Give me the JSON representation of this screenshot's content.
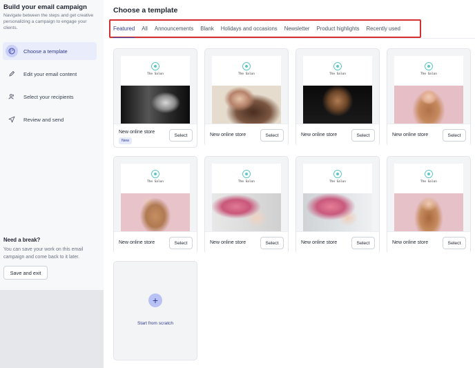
{
  "sidebar": {
    "title": "Build your email campaign",
    "description": "Navigate between the steps and get creative personalizing a campaign to engage your clients.",
    "steps": [
      {
        "label": "Choose a template",
        "icon": "palette-icon",
        "active": true
      },
      {
        "label": "Edit your email content",
        "icon": "pencil-icon",
        "active": false
      },
      {
        "label": "Select your recipients",
        "icon": "users-icon",
        "active": false
      },
      {
        "label": "Review and send",
        "icon": "send-icon",
        "active": false
      }
    ],
    "break_title": "Need a break?",
    "break_description": "You can save your work on this email campaign and come back to it later.",
    "save_exit_label": "Save and exit"
  },
  "main": {
    "title": "Choose a template",
    "tabs": [
      "Featured",
      "All",
      "Announcements",
      "Blank",
      "Holidays and occasions",
      "Newsletter",
      "Product highlights",
      "Recently used"
    ],
    "active_tab": "Featured",
    "cards": [
      {
        "brand": "The Salon",
        "name": "New online store",
        "badge": "New",
        "select": "Select"
      },
      {
        "brand": "The Salon",
        "name": "New online store",
        "badge": "",
        "select": "Select"
      },
      {
        "brand": "The Salon",
        "name": "New online store",
        "badge": "",
        "select": "Select"
      },
      {
        "brand": "The Salon",
        "name": "New online store",
        "badge": "",
        "select": "Select"
      },
      {
        "brand": "The Salon",
        "name": "New online store",
        "badge": "",
        "select": "Select"
      },
      {
        "brand": "The Salon",
        "name": "New online store",
        "badge": "",
        "select": "Select"
      },
      {
        "brand": "The Salon",
        "name": "New online store",
        "badge": "",
        "select": "Select"
      },
      {
        "brand": "The Salon",
        "name": "New online store",
        "badge": "",
        "select": "Select"
      }
    ],
    "scratch_label": "Start from scratch"
  },
  "colors": {
    "accent": "#3b46a8",
    "highlight_border": "#d32f2f",
    "logo": "#5cc8c6"
  }
}
